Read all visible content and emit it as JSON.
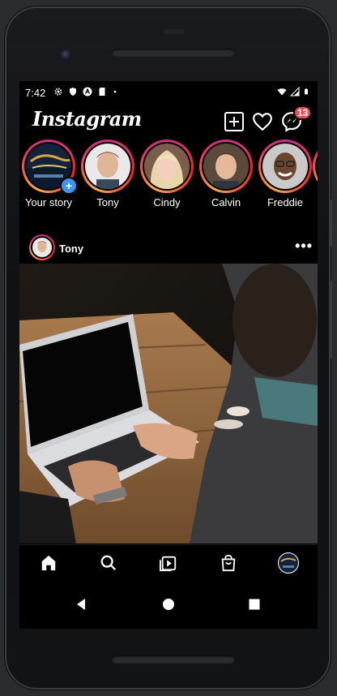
{
  "status_bar": {
    "time": "7:42",
    "left_icons": [
      "gear-icon",
      "shield-icon",
      "a-circle-icon",
      "sd-card-icon",
      "dot-icon"
    ],
    "right_icons": [
      "wifi-icon",
      "signal-icon",
      "battery-icon"
    ]
  },
  "header": {
    "logo_text": "Instagram",
    "new_post_icon": "plus-square-icon",
    "activity_icon": "heart-icon",
    "messenger_icon": "messenger-icon",
    "messenger_badge": "13"
  },
  "stories": [
    {
      "label": "Your story",
      "own": true
    },
    {
      "label": "Tony"
    },
    {
      "label": "Cindy"
    },
    {
      "label": "Calvin"
    },
    {
      "label": "Freddie"
    }
  ],
  "post": {
    "username": "Tony",
    "more_label": "•••"
  },
  "bottom_nav": [
    {
      "icon": "home-icon"
    },
    {
      "icon": "search-icon"
    },
    {
      "icon": "reels-icon"
    },
    {
      "icon": "shop-icon"
    },
    {
      "icon": "profile-avatar"
    }
  ],
  "android_nav": [
    "back-icon",
    "home-circle-icon",
    "recents-icon"
  ],
  "colors": {
    "badge": "#ed4956",
    "story_ring_start": "#c13584",
    "story_ring_end": "#fcaf45",
    "add_story": "#3897f0"
  }
}
